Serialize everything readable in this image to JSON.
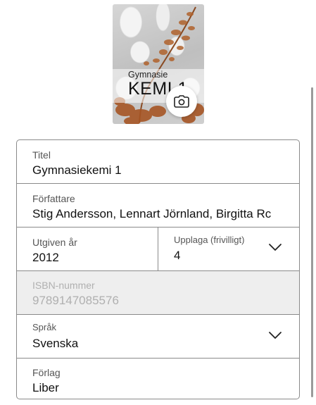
{
  "cover": {
    "subtitle": "Gymnasie",
    "title": "KEMI 1"
  },
  "form": {
    "title": {
      "label": "Titel",
      "value": "Gymnasiekemi 1"
    },
    "author": {
      "label": "Författare",
      "value": "Stig Andersson, Lennart Jörnland, Birgitta Rc"
    },
    "year": {
      "label": "Utgiven år",
      "value": "2012"
    },
    "edition": {
      "label": "Upplaga (frivilligt)",
      "value": "4"
    },
    "isbn": {
      "label": "ISBN-nummer",
      "placeholder": "9789147085576"
    },
    "language": {
      "label": "Språk",
      "value": "Svenska"
    },
    "publisher": {
      "label": "Förlag",
      "value": "Liber"
    }
  },
  "icons": {
    "camera": "camera-icon",
    "chevron": "chevron-down-icon"
  }
}
